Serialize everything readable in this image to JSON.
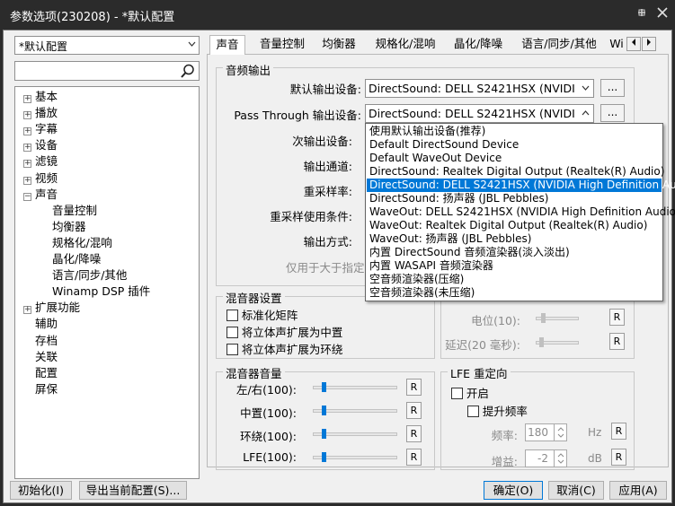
{
  "window": {
    "title": "参数选项(230208) - *默认配置",
    "pin_icon": "pin-icon",
    "close_icon": "close-icon"
  },
  "left": {
    "profile": "*默认配置",
    "search_placeholder": "",
    "tree": [
      {
        "label": "基本",
        "expander": "+"
      },
      {
        "label": "播放",
        "expander": "+"
      },
      {
        "label": "字幕",
        "expander": "+"
      },
      {
        "label": "设备",
        "expander": "+"
      },
      {
        "label": "滤镜",
        "expander": "+"
      },
      {
        "label": "视频",
        "expander": "+"
      },
      {
        "label": "声音",
        "expander": "−"
      },
      {
        "label": "音量控制",
        "expander": ""
      },
      {
        "label": "均衡器",
        "expander": ""
      },
      {
        "label": "规格化/混响",
        "expander": ""
      },
      {
        "label": "晶化/降噪",
        "expander": ""
      },
      {
        "label": "语言/同步/其他",
        "expander": ""
      },
      {
        "label": "Winamp DSP 插件",
        "expander": ""
      },
      {
        "label": "扩展功能",
        "expander": "+"
      },
      {
        "label": "辅助",
        "expander": ""
      },
      {
        "label": "存档",
        "expander": ""
      },
      {
        "label": "关联",
        "expander": ""
      },
      {
        "label": "配置",
        "expander": ""
      },
      {
        "label": "屏保",
        "expander": ""
      }
    ]
  },
  "tabs": [
    "声音",
    "音量控制",
    "均衡器",
    "规格化/混响",
    "晶化/降噪",
    "语言/同步/其他",
    "Wi"
  ],
  "audio_output": {
    "group_title": "音频输出",
    "default_device_label": "默认输出设备:",
    "default_device_value": "DirectSound: DELL S2421HSX (NVIDIA High",
    "passthrough_label": "Pass Through 输出设备:",
    "passthrough_value": "DirectSound: DELL S2421HSX (NVIDIA High",
    "secondary_label": "次输出设备:",
    "channel_label": "输出通道:",
    "resample_label": "重采样率:",
    "resample_cond_label": "重采样使用条件:",
    "output_mode_label": "输出方式:",
    "note_partial": "仅用于大于指定",
    "more_button": "..."
  },
  "dropdown_options": [
    "使用默认输出设备(推荐)",
    "Default DirectSound Device",
    "Default WaveOut Device",
    "DirectSound: Realtek Digital Output (Realtek(R) Audio)",
    "DirectSound: DELL S2421HSX (NVIDIA High Definition Audio)",
    "DirectSound: 扬声器 (JBL Pebbles)",
    "WaveOut: DELL S2421HSX (NVIDIA High Definition Audio)",
    "WaveOut: Realtek Digital Output (Realtek(R) Audio)",
    "WaveOut: 扬声器 (JBL Pebbles)",
    "内置 DirectSound 音频渲染器(淡入淡出)",
    "内置 WASAPI 音频渲染器",
    "空音频渲染器(压缩)",
    "空音频渲染器(未压缩)"
  ],
  "dropdown_highlighted_index": 4,
  "mixer": {
    "group_title": "混音器设置",
    "normalize": "标准化矩阵",
    "stereo_center": "将立体声扩展为中置",
    "stereo_surround": "将立体声扩展为环绕"
  },
  "right_small": {
    "level_label": "电位(10):",
    "delay_label": "延迟(20 毫秒):",
    "reset": "R"
  },
  "mixer_volume": {
    "group_title": "混音器音量",
    "rows": [
      {
        "label": "左/右(100):",
        "level": 0.2
      },
      {
        "label": "中置(100):",
        "level": 0.2
      },
      {
        "label": "环绕(100):",
        "level": 0.2
      },
      {
        "label": "LFE(100):",
        "level": 0.2
      }
    ],
    "reset": "R"
  },
  "lfe": {
    "group_title": "LFE 重定向",
    "enable": "开启",
    "boost": "提升频率",
    "freq_label": "频率:",
    "freq_value": "180",
    "freq_unit": "Hz",
    "gain_label": "增益:",
    "gain_value": "-2",
    "gain_unit": "dB",
    "reset": "R"
  },
  "footer": {
    "init": "初始化(I)",
    "export": "导出当前配置(S)...",
    "ok": "确定(O)",
    "cancel": "取消(C)",
    "apply": "应用(A)"
  },
  "colors": {
    "accent": "#0078d7",
    "titlebar": "#2b2b2b"
  }
}
